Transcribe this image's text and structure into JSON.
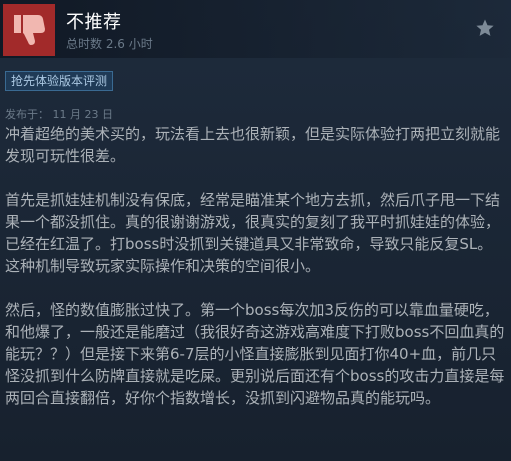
{
  "review": {
    "verdict": "不推荐",
    "playtime": "总时数 2.6 小时",
    "tag": "抢先体验版本评测",
    "posted": "发布于： 11 月 23 日",
    "paragraphs": [
      "冲着超绝的美术买的，玩法看上去也很新颖，但是实际体验打两把立刻就能发现可玩性很差。",
      "首先是抓娃娃机制没有保底，经常是瞄准某个地方去抓，然后爪子甩一下结果一个都没抓住。真的很谢谢游戏，很真实的复刻了我平时抓娃娃的体验，已经在红温了。打boss时没抓到关键道具又非常致命，导致只能反复SL。这种机制导致玩家实际操作和决策的空间很小。",
      "然后，怪的数值膨胀过快了。第一个boss每次加3反伤的可以靠血量硬吃，和他爆了，一般还是能磨过（我很好奇这游戏高难度下打败boss不回血真的能玩？？）但是接下来第6-7层的小怪直接膨胀到见面打你40+血，前几只怪没抓到什么防牌直接就是吃屎。更别说后面还有个boss的攻击力直接是每两回合直接翻倍，好你个指数增长，没抓到闪避物品真的能玩吗。"
    ]
  },
  "icons": {
    "verdict_icon": "thumbs-down-icon",
    "corner_icon": "star-icon"
  },
  "colors": {
    "thumb_bg": "#a22a2a",
    "background": "#1b2838",
    "text": "#acb2b8"
  }
}
